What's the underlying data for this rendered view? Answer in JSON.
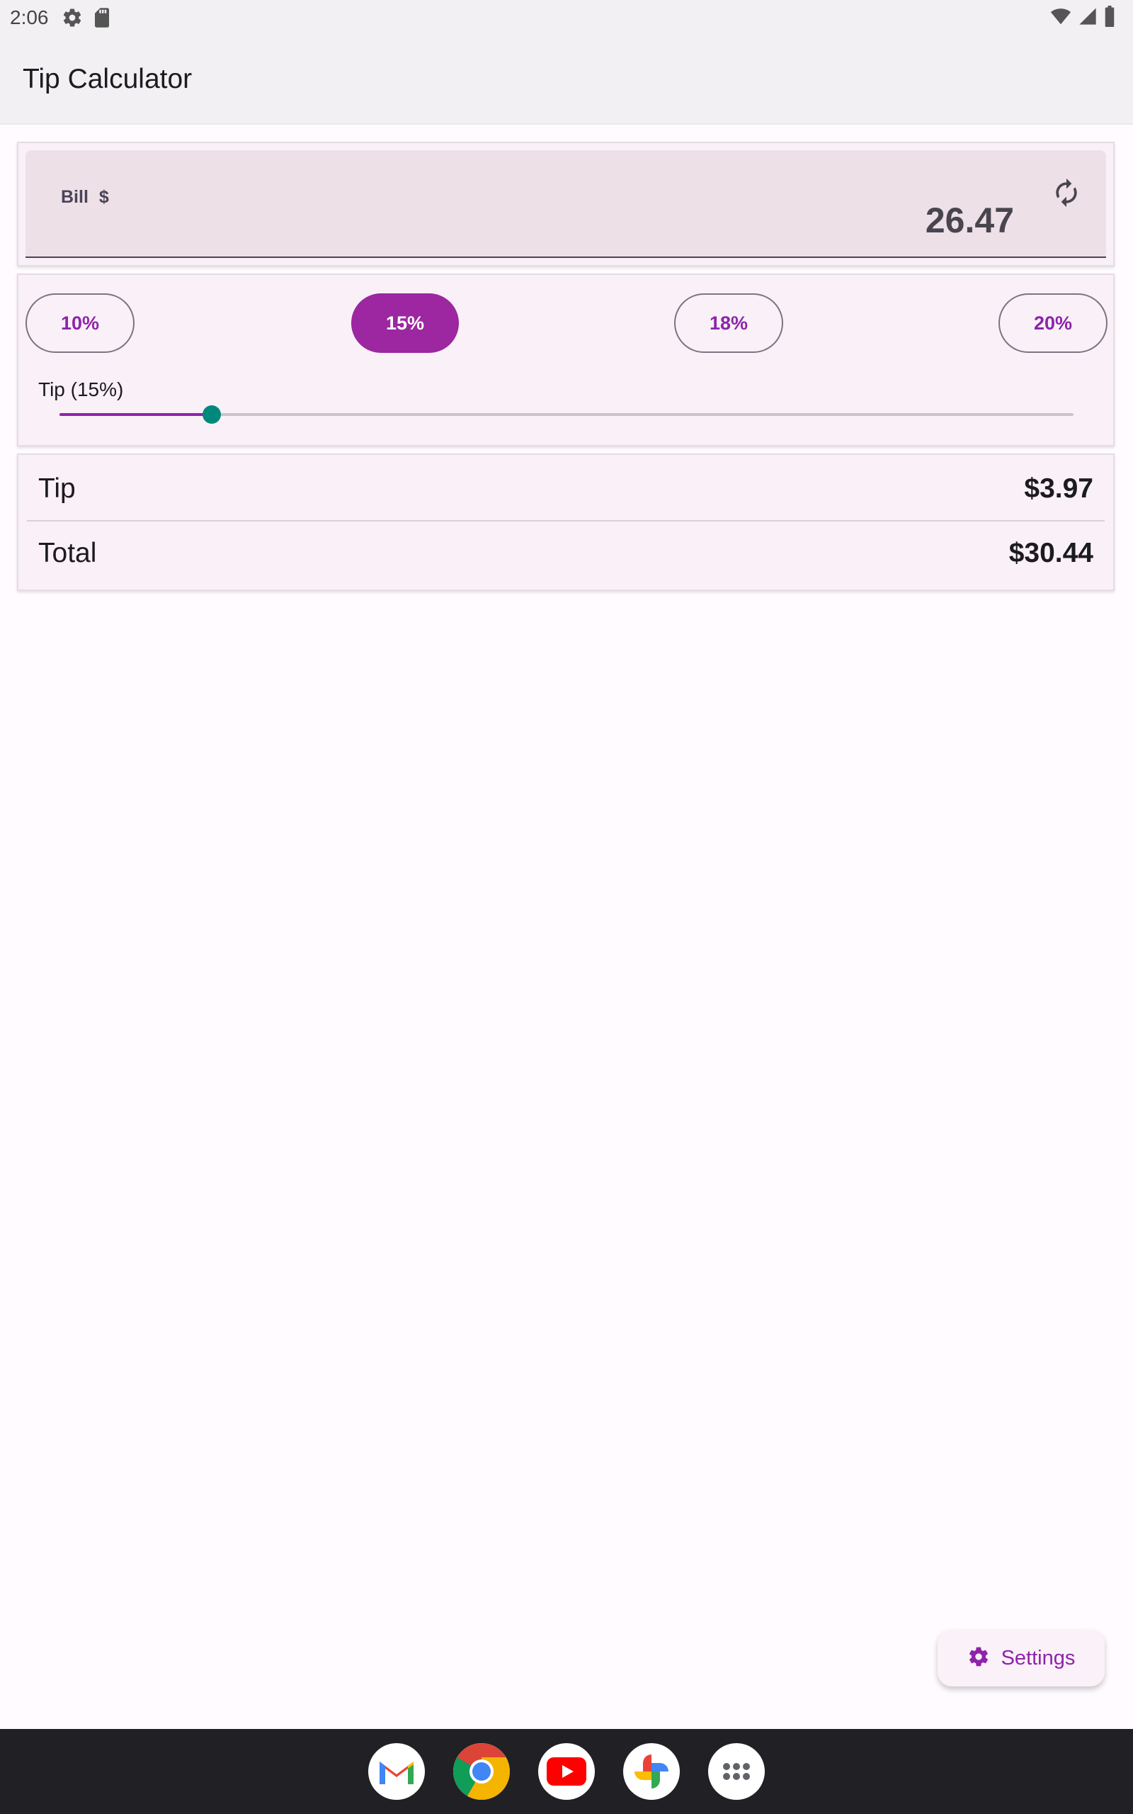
{
  "status_bar": {
    "time": "2:06",
    "icons": [
      "settings-gear-icon",
      "sd-card-icon",
      "wifi-icon",
      "signal-icon",
      "battery-icon"
    ]
  },
  "app_bar": {
    "title": "Tip Calculator"
  },
  "bill": {
    "label": "Bill",
    "currency": "$",
    "value": "26.47",
    "reset_icon": "refresh-icon"
  },
  "tip_presets": {
    "chips": [
      {
        "label": "10%",
        "selected": false
      },
      {
        "label": "15%",
        "selected": true
      },
      {
        "label": "18%",
        "selected": false
      },
      {
        "label": "20%",
        "selected": false
      }
    ],
    "slider_label": "Tip (15%)",
    "slider_fraction": 0.15
  },
  "results": {
    "tip_label": "Tip",
    "tip_value": "$3.97",
    "total_label": "Total",
    "total_value": "$30.44"
  },
  "settings_button": {
    "label": "Settings",
    "icon": "gear-icon"
  },
  "dock": {
    "apps": [
      "gmail-icon",
      "chrome-icon",
      "youtube-icon",
      "photos-icon",
      "app-drawer-icon"
    ]
  },
  "colors": {
    "accent": "#8e24aa",
    "accent_selected": "#9c27a0",
    "slider_thumb": "#00897b",
    "background": "#fffbfe"
  }
}
